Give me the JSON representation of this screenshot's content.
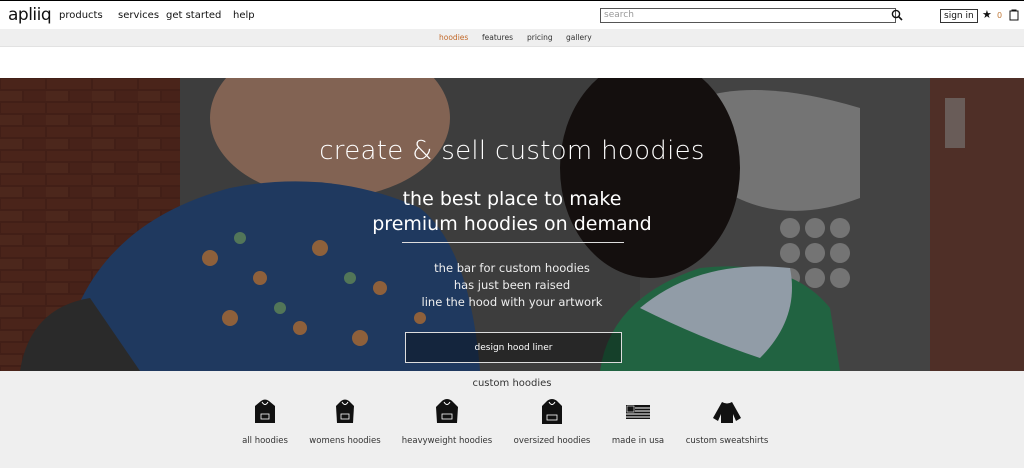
{
  "header": {
    "logo": "apliiq",
    "nav": [
      {
        "label": "products"
      },
      {
        "label": "services"
      },
      {
        "label": "get started"
      },
      {
        "label": "help"
      }
    ],
    "search_placeholder": "search",
    "signin_label": "sign in",
    "cart_count": "0"
  },
  "subnav": {
    "items": [
      {
        "label": "hoodies",
        "active": true
      },
      {
        "label": "features"
      },
      {
        "label": "pricing"
      },
      {
        "label": "gallery"
      }
    ],
    "active_color": "#c2692a"
  },
  "hero": {
    "title": "create & sell custom hoodies",
    "subtitle_line1": "the best place to make",
    "subtitle_line2": "premium hoodies on demand",
    "body_line1": "the bar for custom hoodies",
    "body_line2": "has just been raised",
    "body_line3": "line the hood with your artwork",
    "cta_label": "design hood liner"
  },
  "categories": {
    "title": "custom hoodies",
    "items": [
      {
        "label": "all hoodies",
        "icon": "hoodie-icon"
      },
      {
        "label": "womens hoodies",
        "icon": "womens-hoodie-icon"
      },
      {
        "label": "heavyweight hoodies",
        "icon": "heavyweight-hoodie-icon"
      },
      {
        "label": "oversized hoodies",
        "icon": "oversized-hoodie-icon"
      },
      {
        "label": "made in usa",
        "icon": "usa-flag-icon"
      },
      {
        "label": "custom sweatshirts",
        "icon": "sweatshirt-icon"
      }
    ]
  }
}
